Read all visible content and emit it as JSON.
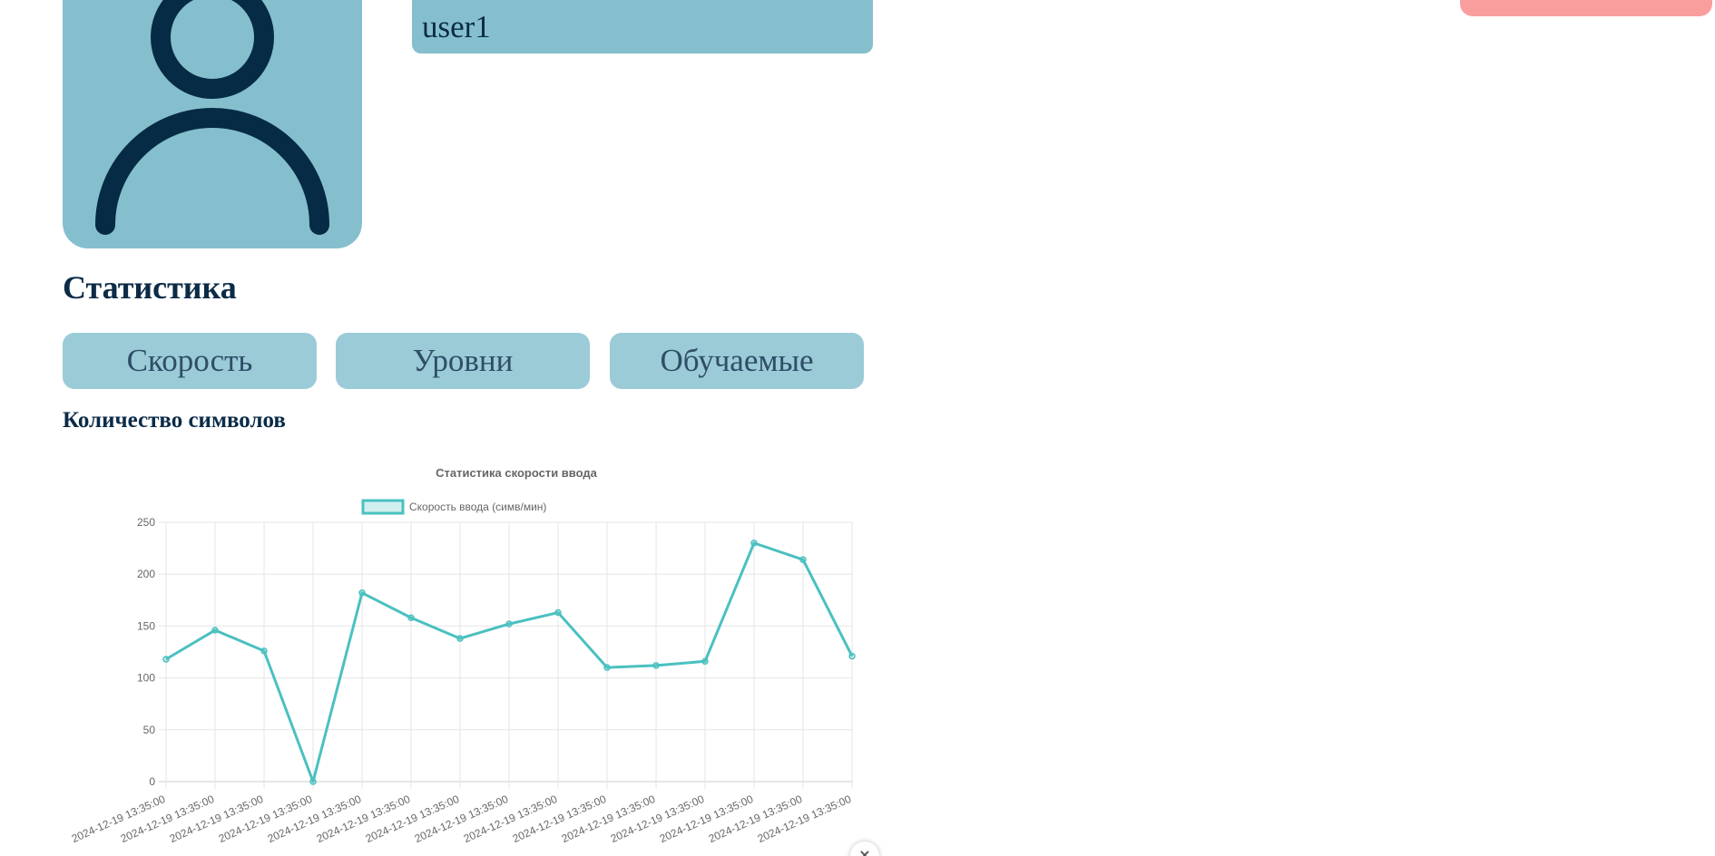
{
  "profile": {
    "username": "user1",
    "avatar_icon": "user-silhouette-icon"
  },
  "colors": {
    "panel": "#85bfcd",
    "tab": "#9ccbd8",
    "accent_red": "#fa9d9d",
    "dark": "#0b2b47",
    "line": "#4bc0c0"
  },
  "statistics": {
    "title": "Статистика",
    "tabs": [
      "Скорость",
      "Уровни",
      "Обучаемые"
    ],
    "subtitle": "Количество символов"
  },
  "chart_data": {
    "type": "line",
    "title": "Статистика скорости ввода",
    "legend_position": "top",
    "grid": true,
    "xlabel": "",
    "ylabel": "",
    "ylim": [
      0,
      250
    ],
    "yticks": [
      0,
      50,
      100,
      150,
      200,
      250
    ],
    "categories": [
      "2024-12-19 13:35:00",
      "2024-12-19 13:35:00",
      "2024-12-19 13:35:00",
      "2024-12-19 13:35:00",
      "2024-12-19 13:35:00",
      "2024-12-19 13:35:00",
      "2024-12-19 13:35:00",
      "2024-12-19 13:35:00",
      "2024-12-19 13:35:00",
      "2024-12-19 13:35:00",
      "2024-12-19 13:35:00",
      "2024-12-19 13:35:00",
      "2024-12-19 13:35:00",
      "2024-12-19 13:35:00",
      "2024-12-19 13:35:00"
    ],
    "series": [
      {
        "name": "Скорость ввода (симв/мин)",
        "color": "#4bc0c0",
        "values": [
          118,
          146,
          126,
          0,
          182,
          158,
          138,
          152,
          163,
          110,
          112,
          116,
          230,
          214,
          121
        ]
      }
    ]
  },
  "close_button": {
    "label": "×",
    "icon": "close-icon"
  }
}
